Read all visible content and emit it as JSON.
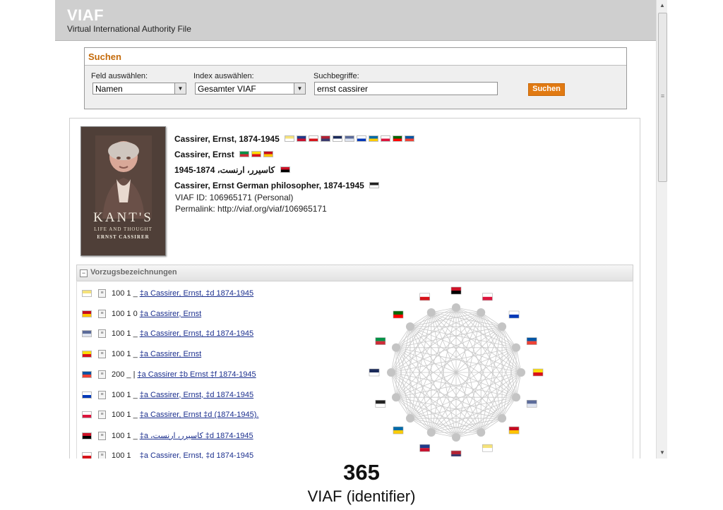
{
  "app": {
    "logo": "VIAF",
    "subtitle": "Virtual International Authority File"
  },
  "search": {
    "title": "Suchen",
    "field_label": "Feld auswählen:",
    "field_value": "Namen",
    "index_label": "Index auswählen:",
    "index_value": "Gesamter VIAF",
    "terms_label": "Suchbegriffe:",
    "terms_value": "ernst cassirer",
    "button_label": "Suchen"
  },
  "record": {
    "cover": {
      "title": "KANT'S",
      "subtitle": "LIFE AND THOUGHT",
      "author": "ERNST CASSIRER"
    },
    "headings": [
      {
        "text": "Cassirer, Ernst, 1874-1945",
        "flags": [
          "vatican",
          "australia",
          "czech",
          "usa",
          "dnb",
          "nla-doc",
          "israel",
          "sweden",
          "poland",
          "portugal",
          "france"
        ]
      },
      {
        "text": "Cassirer, Ernst",
        "flags": [
          "italy",
          "catalonia",
          "spain"
        ]
      },
      {
        "text": "1945-1874 ،کاسیرر، ارنست",
        "flags": [
          "egypt"
        ]
      },
      {
        "text": "Cassirer, Ernst German philosopher, 1874-1945",
        "flags": [
          "qr"
        ]
      }
    ],
    "viaf_id": "VIAF ID: 106965171 (Personal)",
    "permalink": "Permalink: http://viaf.org/viaf/106965171"
  },
  "preferred": {
    "title": "Vorzugsbezeichnungen",
    "rows": [
      {
        "flag": "vatican",
        "code": "100 1 _",
        "link": "‡a  Cassirer, Ernst, ‡d  1874-1945"
      },
      {
        "flag": "spain",
        "code": "100 1 0",
        "link": "‡a  Cassirer, Ernst"
      },
      {
        "flag": "nla-doc",
        "code": "100 1 _",
        "link": "‡a  Cassirer, Ernst, ‡d  1874-1945"
      },
      {
        "flag": "catalonia",
        "code": "100 1 _",
        "link": "‡a  Cassirer, Ernst"
      },
      {
        "flag": "france",
        "code": "200 _ |",
        "link": "‡a  Cassirer ‡b  Ernst ‡f  1874-1945"
      },
      {
        "flag": "israel",
        "code": "100 1 _",
        "link": "‡a  Cassirer, Ernst, ‡d  1874-1945"
      },
      {
        "flag": "poland",
        "code": "100 1 _",
        "link": "‡a  Cassirer, Ernst ‡d  (1874-1945)."
      },
      {
        "flag": "egypt",
        "code": "100 1 _",
        "link": "‡a  ،کاسیرر، ارنست ‡d  1874-1945"
      },
      {
        "flag": "czech",
        "code": "100 1 _",
        "link": "‡a  Cassirer, Ernst, ‡d  1874-1945"
      }
    ]
  },
  "graph_nodes": [
    "egypt",
    "poland",
    "israel",
    "france",
    "catalonia",
    "nla-doc",
    "spain",
    "vatican",
    "usa",
    "australia",
    "sweden",
    "qr",
    "dnb",
    "italy",
    "portugal",
    "czech"
  ],
  "flag_colors": {
    "vatican": [
      "#f5e27a",
      "#ffffff"
    ],
    "australia": [
      "#1f3a8a",
      "#c8102e"
    ],
    "czech": [
      "#ffffff",
      "#d7141a"
    ],
    "usa": [
      "#b22234",
      "#3c3b6e"
    ],
    "dnb": [
      "#1a2a5a",
      "#ffffff"
    ],
    "nla-doc": [
      "#5b6b9a",
      "#dfe4ef"
    ],
    "israel": [
      "#ffffff",
      "#0038b8"
    ],
    "sweden": [
      "#006aa7",
      "#fecc00"
    ],
    "poland": [
      "#ffffff",
      "#dc143c"
    ],
    "portugal": [
      "#006600",
      "#ff0000"
    ],
    "france": [
      "#0055a4",
      "#ef4135"
    ],
    "italy": [
      "#009246",
      "#ce2b37"
    ],
    "catalonia": [
      "#fcdd09",
      "#da121a"
    ],
    "spain": [
      "#c60b1e",
      "#ffc400"
    ],
    "egypt": [
      "#ce1126",
      "#000000"
    ],
    "qr": [
      "#222222",
      "#ffffff"
    ]
  },
  "caption": {
    "number": "365",
    "text": "VIAF (identifier)"
  }
}
